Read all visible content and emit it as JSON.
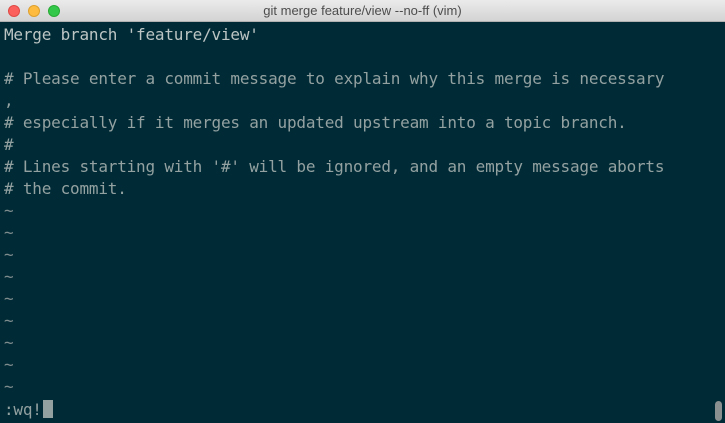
{
  "window": {
    "title": "git merge feature/view --no-ff (vim)"
  },
  "editor": {
    "lines": [
      "Merge branch 'feature/view'",
      "",
      "# Please enter a commit message to explain why this merge is necessary",
      ",",
      "# especially if it merges an updated upstream into a topic branch.",
      "#",
      "# Lines starting with '#' will be ignored, and an empty message aborts",
      "# the commit."
    ],
    "tildes": [
      "~",
      "~",
      "~",
      "~",
      "~",
      "~",
      "~",
      "~",
      "~"
    ],
    "command_line": ":wq!"
  }
}
